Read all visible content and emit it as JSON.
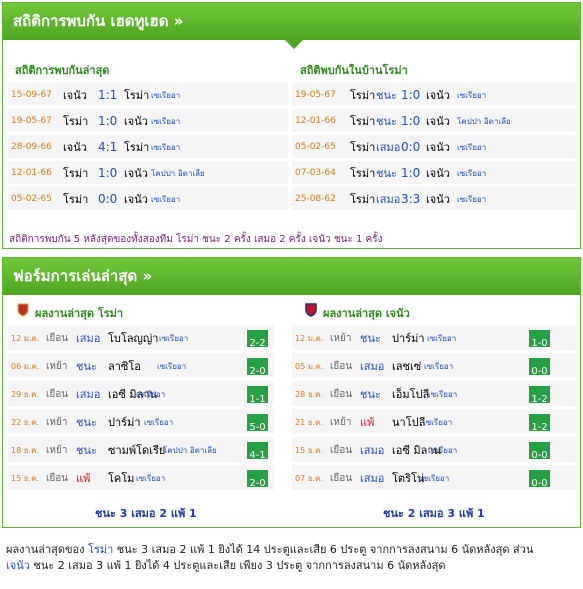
{
  "h2h": {
    "title": "สถิติการพบกัน เฮดทูเฮด »",
    "left_title": "สถิติการพบกันล่าสุด",
    "right_title": "สถิติพบกันในบ้านโรม่า",
    "left_rows": [
      {
        "date": "15-09-67",
        "home": "เจนัว",
        "score": "1:1",
        "away": "โรม่า",
        "league": "เซเรียอา",
        "result": ""
      },
      {
        "date": "19-05-67",
        "home": "โรม่า",
        "score": "1:0",
        "away": "เจนัว",
        "league": "เซเรียอา",
        "result": ""
      },
      {
        "date": "28-09-66",
        "home": "เจนัว",
        "score": "4:1",
        "away": "โรม่า",
        "league": "เซเรียอา",
        "result": ""
      },
      {
        "date": "12-01-66",
        "home": "โรม่า",
        "score": "1:0",
        "away": "เจนัว",
        "league": "โคปปา อิตาเลีย",
        "result": ""
      },
      {
        "date": "05-02-65",
        "home": "โรม่า",
        "score": "0:0",
        "away": "เจนัว",
        "league": "เซเรียอา",
        "result": ""
      }
    ],
    "right_rows": [
      {
        "date": "19-05-67",
        "home": "โรม่า",
        "result": "ชนะ",
        "score": "1:0",
        "away": "เจนัว",
        "league": "เซเรียอา"
      },
      {
        "date": "12-01-66",
        "home": "โรม่า",
        "result": "ชนะ",
        "score": "1:0",
        "away": "เจนัว",
        "league": "โคปปา อิตาเลีย"
      },
      {
        "date": "05-02-65",
        "home": "โรม่า",
        "result": "เสมอ",
        "score": "0:0",
        "away": "เจนัว",
        "league": "เซเรียอา"
      },
      {
        "date": "07-03-64",
        "home": "โรม่า",
        "result": "ชนะ",
        "score": "1:0",
        "away": "เจนัว",
        "league": "เซเรียอา"
      },
      {
        "date": "25-08-62",
        "home": "โรม่า",
        "result": "เสมอ",
        "score": "3:3",
        "away": "เจนัว",
        "league": "เซเรียอา"
      }
    ],
    "summary": "สถิติการพบกัน 5 หลังสุดของทั้งสองทีม โรม่า ชนะ 2 ครั้ง เสมอ 2 ครั้ง เจนัว ชนะ 1 ครั้ง"
  },
  "form": {
    "title": "ฟอร์มการเล่นล่าสุด »",
    "left_title": "ผลงานล่าสุด โรม่า",
    "right_title": "ผลงานล่าสุด เจนัว",
    "left_rows": [
      {
        "date": "12 ม.ค.",
        "venue": "เยือน",
        "result": "เสมอ",
        "opponent": "โบโลญญ่า",
        "league": "เซเรียอา",
        "score": "2-2"
      },
      {
        "date": "06 ม.ค.",
        "venue": "เหย้า",
        "result": "ชนะ",
        "opponent": "ลาซิโอ",
        "league": "เซเรียอา",
        "score": "2-0"
      },
      {
        "date": "29 ธ.ค.",
        "venue": "เยือน",
        "result": "เสมอ",
        "opponent": "เอซี มิลาน",
        "league": "เซเรียอา",
        "score": "1-1"
      },
      {
        "date": "22 ธ.ค.",
        "venue": "เหย้า",
        "result": "ชนะ",
        "opponent": "ปาร์ม่า",
        "league": "เซเรียอา",
        "score": "5-0"
      },
      {
        "date": "18 ธ.ค.",
        "venue": "เหย้า",
        "result": "ชนะ",
        "opponent": "ซามพ์โดเรีย",
        "league": "โคปปา อิตาเลีย",
        "score": "4-1"
      },
      {
        "date": "15 ธ.ค.",
        "venue": "เยือน",
        "result": "แพ้",
        "opponent": "โคโม",
        "league": "เซเรียอา",
        "score": "2-0"
      }
    ],
    "right_rows": [
      {
        "date": "12 ม.ค.",
        "venue": "เหย้า",
        "result": "ชนะ",
        "opponent": "ปาร์ม่า",
        "league": "เซเรียอา",
        "score": "1-0"
      },
      {
        "date": "05 ม.ค.",
        "venue": "เยือน",
        "result": "เสมอ",
        "opponent": "เลชเซ่",
        "league": "เซเรียอา",
        "score": "0-0"
      },
      {
        "date": "28 ธ.ค.",
        "venue": "เยือน",
        "result": "ชนะ",
        "opponent": "เอ็มโปลี",
        "league": "เซเรียอา",
        "score": "1-2"
      },
      {
        "date": "21 ธ.ค.",
        "venue": "เหย้า",
        "result": "แพ้",
        "opponent": "นาโปลี",
        "league": "เซเรียอา",
        "score": "1-2"
      },
      {
        "date": "15 ธ.ค.",
        "venue": "เยือน",
        "result": "เสมอ",
        "opponent": "เอซี มิลาน",
        "league": "เซเรียอา",
        "score": "0-0"
      },
      {
        "date": "07 ธ.ค.",
        "venue": "เยือน",
        "result": "เสมอ",
        "opponent": "โตริโน่",
        "league": "เซเรียอา",
        "score": "0-0"
      }
    ],
    "left_total": "ชนะ 3 เสมอ 2 แพ้ 1",
    "right_total": "ชนะ 2 เสมอ 3 แพ้ 1"
  },
  "footer": {
    "line1_pre": "ผลงานล่าสุดของ",
    "line1_team": "โรม่า",
    "line1_post": "ชนะ 3 เสมอ 2 แพ้ 1 ยิงได้ 14 ประตูและเสีย 6 ประตู จากการลงสนาม 6 นัดหลังสุด ส่วน",
    "line2_team": "เจนัว",
    "line2_post": "ชนะ 2 เสมอ 3 แพ้ 1 ยิงได้ 4 ประตูและเสีย เพียง 3 ประตู จากการลงสนาม 6 นัดหลังสุด"
  },
  "colors": {
    "win": "#1d4fc8",
    "draw": "#1d4fc8",
    "loss": "#d8141c",
    "badge": "#279f43"
  }
}
